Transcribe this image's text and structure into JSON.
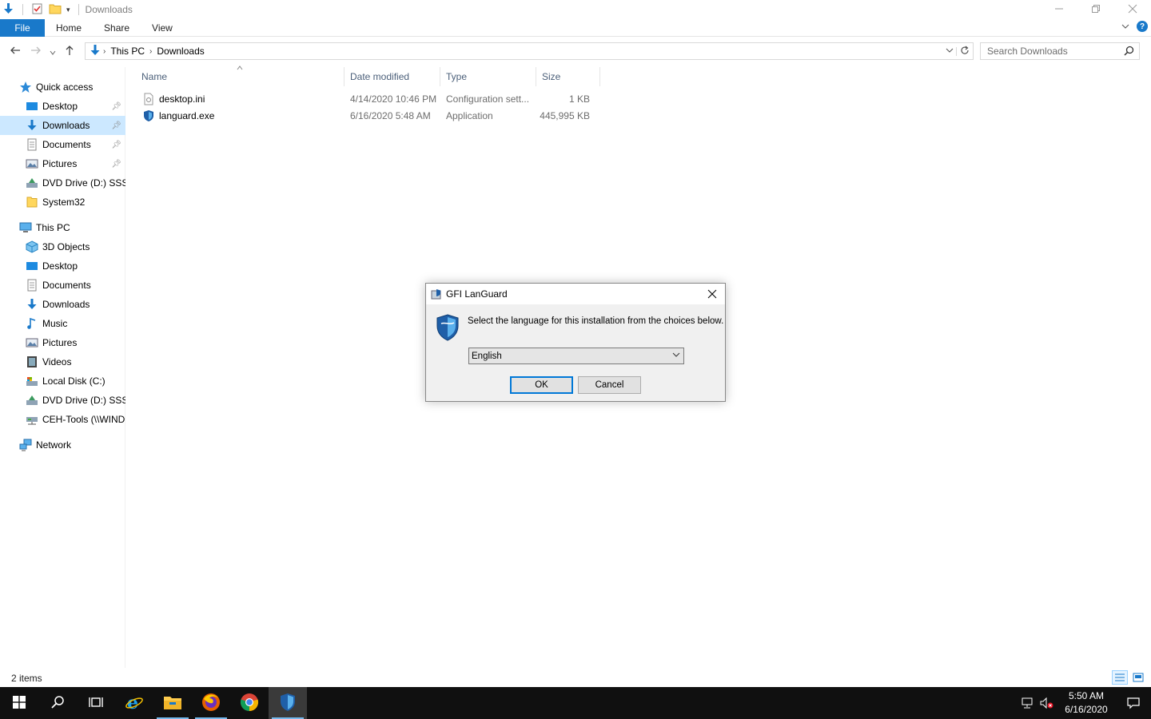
{
  "window": {
    "title": "Downloads",
    "controls": [
      "minimize-icon",
      "restore-icon",
      "close-icon"
    ]
  },
  "ribbon": {
    "tabs": [
      "File",
      "Home",
      "Share",
      "View"
    ]
  },
  "address_bar": {
    "breadcrumb": [
      "This PC",
      "Downloads"
    ],
    "search_placeholder": "Search Downloads"
  },
  "nav_pane": {
    "quick_access": {
      "label": "Quick access",
      "items": [
        {
          "label": "Desktop",
          "icon": "desktop-icon",
          "pinned": true
        },
        {
          "label": "Downloads",
          "icon": "downloads-icon",
          "pinned": true,
          "selected": true
        },
        {
          "label": "Documents",
          "icon": "documents-icon",
          "pinned": true
        },
        {
          "label": "Pictures",
          "icon": "pictures-icon",
          "pinned": true
        },
        {
          "label": "DVD Drive (D:) SSS_X",
          "icon": "dvd-drive-icon",
          "pinned": false
        },
        {
          "label": "System32",
          "icon": "folder-icon",
          "pinned": false
        }
      ]
    },
    "this_pc": {
      "label": "This PC",
      "items": [
        {
          "label": "3D Objects",
          "icon": "3d-objects-icon"
        },
        {
          "label": "Desktop",
          "icon": "desktop-icon"
        },
        {
          "label": "Documents",
          "icon": "documents-icon"
        },
        {
          "label": "Downloads",
          "icon": "downloads-icon"
        },
        {
          "label": "Music",
          "icon": "music-icon"
        },
        {
          "label": "Pictures",
          "icon": "pictures-icon"
        },
        {
          "label": "Videos",
          "icon": "videos-icon"
        },
        {
          "label": "Local Disk (C:)",
          "icon": "local-disk-icon"
        },
        {
          "label": "DVD Drive (D:) SSS_X",
          "icon": "dvd-drive-icon"
        },
        {
          "label": "CEH-Tools (\\\\WINDOWS",
          "icon": "network-drive-icon"
        }
      ]
    },
    "network": {
      "label": "Network"
    }
  },
  "file_list": {
    "columns": [
      "Name",
      "Date modified",
      "Type",
      "Size"
    ],
    "files": [
      {
        "name": "desktop.ini",
        "date": "4/14/2020 10:46 PM",
        "type": "Configuration sett...",
        "size": "1 KB",
        "icon": "settings-file-icon"
      },
      {
        "name": "languard.exe",
        "date": "6/16/2020 5:48 AM",
        "type": "Application",
        "size": "445,995 KB",
        "icon": "languard-shield-icon"
      }
    ]
  },
  "status_bar": {
    "item_count": "2 items"
  },
  "dialog": {
    "title": "GFI LanGuard",
    "message": "Select the language for this installation from the choices below.",
    "language_value": "English",
    "ok_label": "OK",
    "cancel_label": "Cancel"
  },
  "taskbar": {
    "apps": [
      "start-icon",
      "search-icon",
      "task-view-icon",
      "internet-explorer-icon",
      "file-explorer-icon",
      "firefox-icon",
      "chrome-icon",
      "languard-icon"
    ],
    "time": "5:50 AM",
    "date": "6/16/2020"
  },
  "colors": {
    "accent": "#1979ca",
    "selection": "#cce8ff",
    "taskbar": "#101010"
  }
}
